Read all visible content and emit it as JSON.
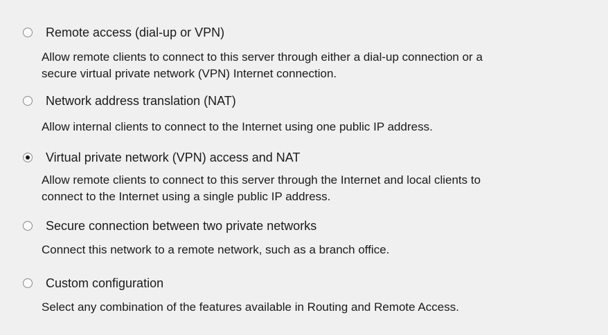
{
  "options": [
    {
      "label": "Remote access (dial-up or VPN)",
      "desc_line1": "Allow remote clients to connect to this server through either a dial-up connection or a",
      "desc_line2": "secure virtual private network (VPN) Internet connection.",
      "selected": false
    },
    {
      "label": "Network address translation (NAT)",
      "desc_line1": "Allow internal clients to connect to the Internet using one public IP address.",
      "selected": false
    },
    {
      "label": "Virtual private network (VPN) access and NAT",
      "desc_line1": "Allow remote clients to connect to this server through the Internet and local clients to",
      "desc_line2": "connect to the Internet using a single public IP address.",
      "selected": true
    },
    {
      "label": "Secure connection between two private networks",
      "desc_line1": "Connect this network to a remote network, such as a branch office.",
      "selected": false
    },
    {
      "label": "Custom configuration",
      "desc_line1": "Select any combination of the features available in Routing and Remote Access.",
      "selected": false
    }
  ]
}
